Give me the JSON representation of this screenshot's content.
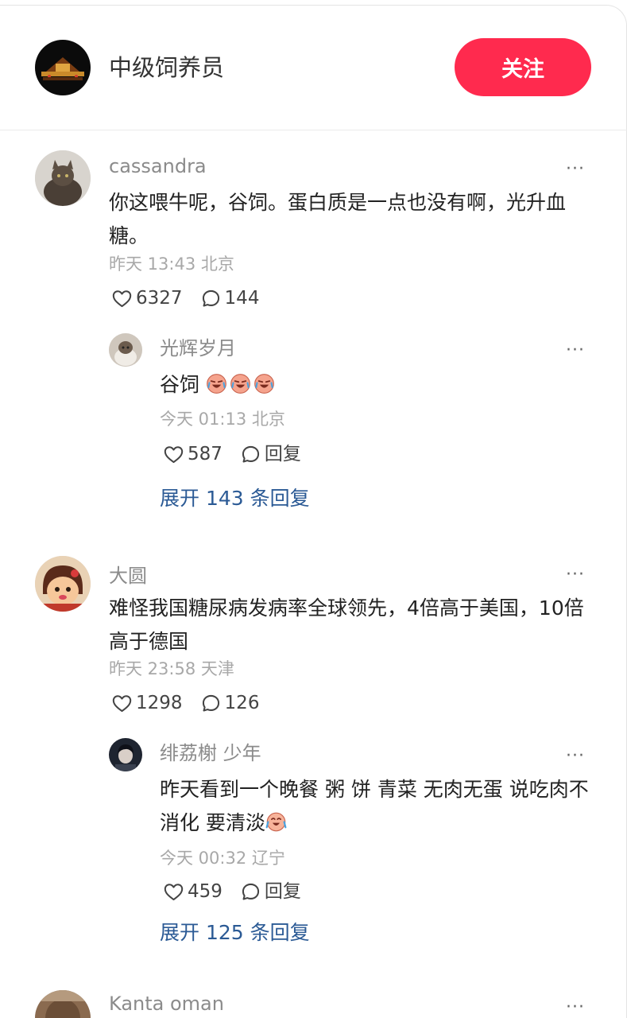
{
  "header": {
    "author_name": "中级饲养员",
    "follow_label": "关注"
  },
  "comments": [
    {
      "user": "cassandra",
      "text": "你这喂牛呢，谷饲。蛋白质是一点也没有啊，光升血糖。",
      "meta": "昨天 13:43 北京",
      "likes": "6327",
      "replies_count": "144",
      "reply": {
        "user": "光辉岁月",
        "text": "谷饲",
        "emojis": [
          "crying-laugh-emoji",
          "crying-laugh-emoji",
          "crying-laugh-emoji"
        ],
        "meta": "今天 01:13 北京",
        "likes": "587",
        "reply_label": "回复"
      },
      "expand_label": "展开 143 条回复"
    },
    {
      "user": "大圆",
      "text": "难怪我国糖尿病发病率全球领先，4倍高于美国，10倍高于德国",
      "meta": "昨天 23:58 天津",
      "likes": "1298",
      "replies_count": "126",
      "reply": {
        "user": "绯荔榭 少年",
        "text": "昨天看到一个晚餐 粥 饼 青菜 无肉无蛋 说吃肉不消化 要清淡",
        "emojis": [
          "tears-of-joy-emoji"
        ],
        "meta": "今天 00:32 辽宁",
        "likes": "459",
        "reply_label": "回复"
      },
      "expand_label": "展开 125 条回复"
    },
    {
      "user": "Kanta oman"
    }
  ],
  "more_glyph": "···",
  "colors": {
    "accent": "#ff2a4e",
    "link": "#2b5a95"
  },
  "icons": [
    "heart-icon",
    "comment-icon",
    "more-icon"
  ]
}
